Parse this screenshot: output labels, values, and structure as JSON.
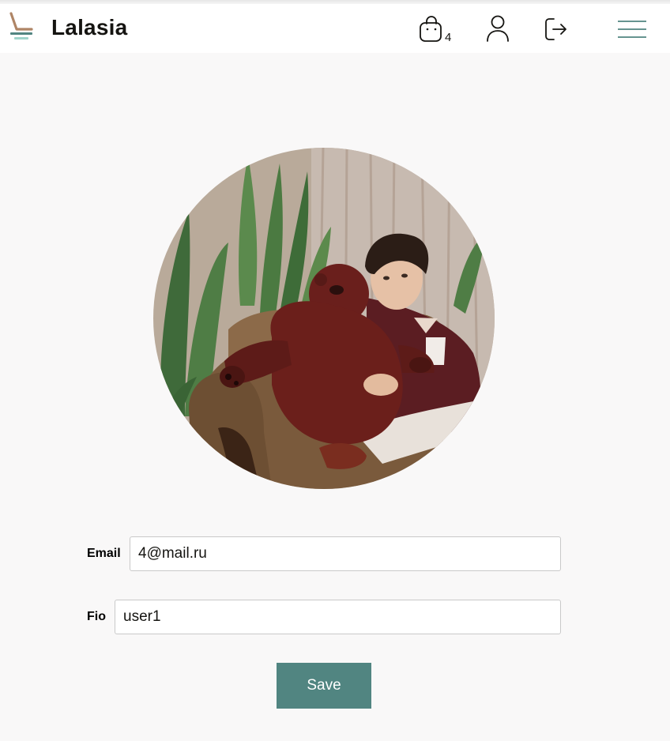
{
  "header": {
    "brand": "Lalasia",
    "cart_count": "4",
    "icons": {
      "logo": "lounge-chair-logo",
      "cart": "shopping-bag-icon",
      "profile": "user-icon",
      "logout": "logout-icon",
      "menu": "hamburger-menu-icon"
    }
  },
  "profile": {
    "photo": "profile-photo",
    "email_label": "Email",
    "email_value": "4@mail.ru",
    "fio_label": "Fio",
    "fio_value": "user1",
    "save_label": "Save"
  },
  "colors": {
    "accent": "#518581",
    "logo_brown": "#af8566",
    "logo_teal": "#9fd4cb",
    "text": "#151411",
    "background": "#f9f8f8"
  }
}
